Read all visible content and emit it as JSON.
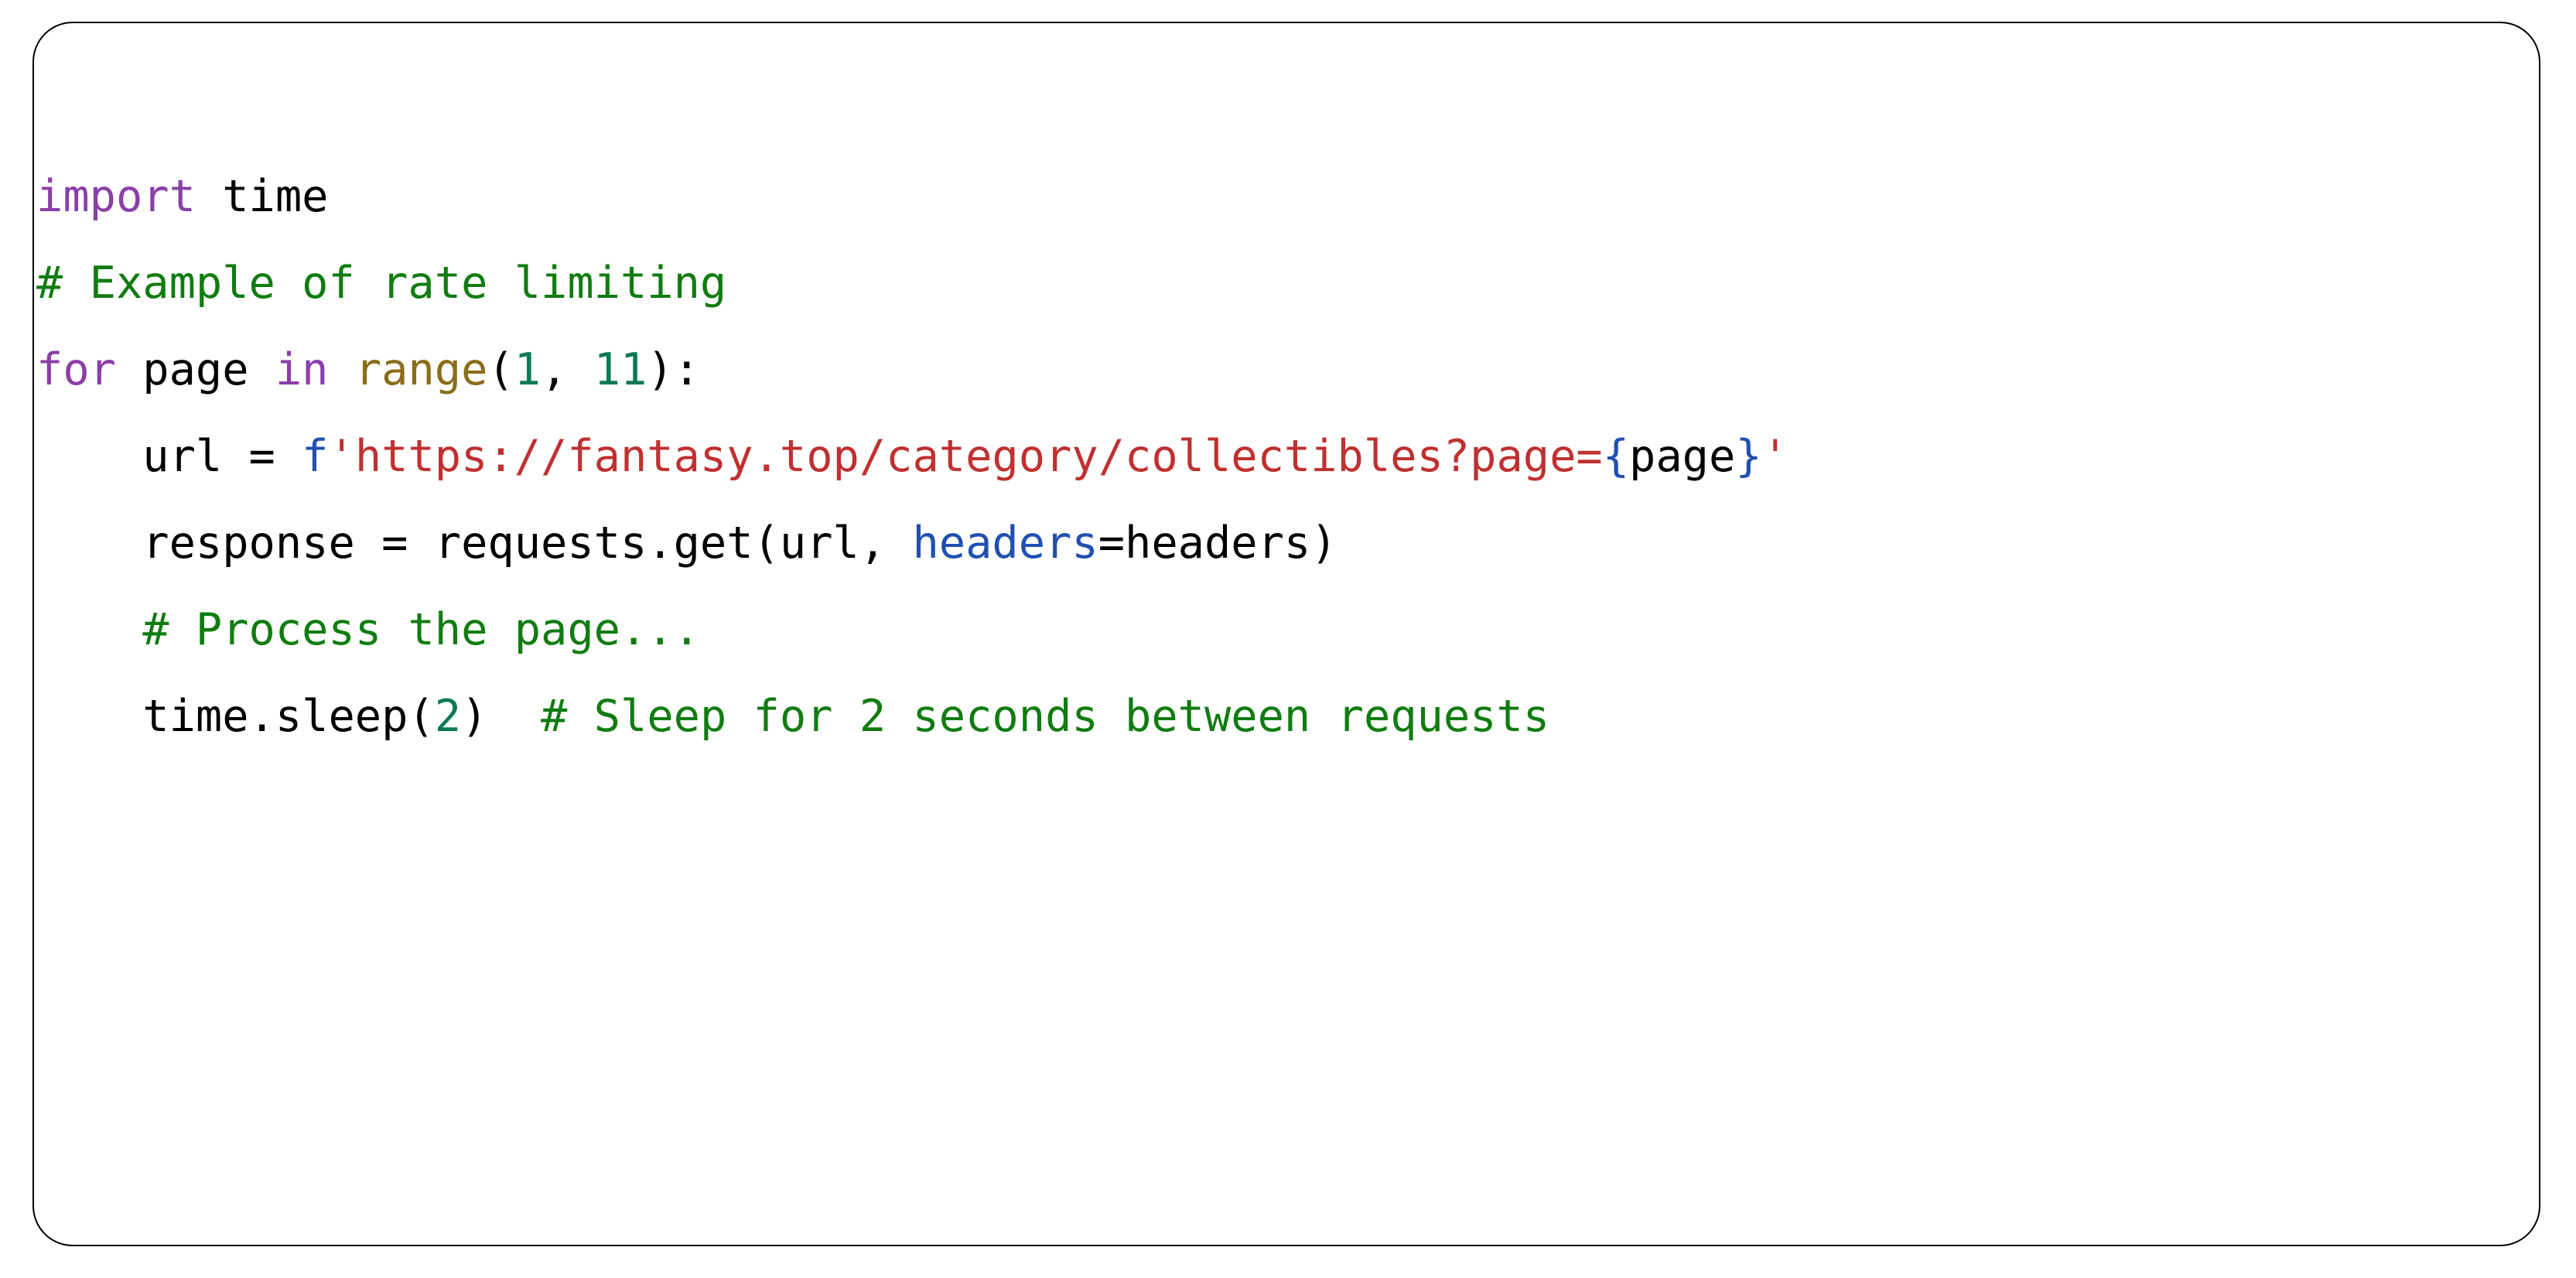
{
  "card": {
    "border_color": "#000000",
    "background": "#ffffff",
    "corner_radius_px": 52
  },
  "code": {
    "language": "python",
    "font_size_px": 57,
    "line_height_px": 112,
    "theme_colors": {
      "keyword": "#8a3fa8",
      "comment": "#107c10",
      "builtin": "#8a6d1a",
      "number": "#0a7a55",
      "string": "#c03030",
      "fstring_prefix": "#2050b0",
      "fstring_brace": "#2050b0",
      "keyword_argument": "#2050b0",
      "plain": "#000000"
    },
    "plain_text": "import time\n# Example of rate limiting\nfor page in range(1, 11):\n    url = f'https://fantasy.top/category/collectibles?page={page}'\n    response = requests.get(url, headers=headers)\n    # Process the page...\n    time.sleep(2)  # Sleep for 2 seconds between requests",
    "lines": [
      {
        "index": 1,
        "tokens": [
          {
            "t": "import",
            "k": "keyword"
          },
          {
            "t": " time",
            "k": "plain"
          }
        ]
      },
      {
        "index": 2,
        "tokens": [
          {
            "t": "# Example of rate limiting",
            "k": "comment"
          }
        ]
      },
      {
        "index": 3,
        "tokens": [
          {
            "t": "for",
            "k": "keyword"
          },
          {
            "t": " page ",
            "k": "plain"
          },
          {
            "t": "in",
            "k": "keyword"
          },
          {
            "t": " ",
            "k": "plain"
          },
          {
            "t": "range",
            "k": "builtin"
          },
          {
            "t": "(",
            "k": "plain"
          },
          {
            "t": "1",
            "k": "number"
          },
          {
            "t": ", ",
            "k": "plain"
          },
          {
            "t": "11",
            "k": "number"
          },
          {
            "t": "):",
            "k": "plain"
          }
        ]
      },
      {
        "index": 4,
        "tokens": [
          {
            "t": "    url = ",
            "k": "plain"
          },
          {
            "t": "f",
            "k": "fprefix"
          },
          {
            "t": "'https://fantasy.top/category/collectibles?page=",
            "k": "string"
          },
          {
            "t": "{",
            "k": "brace"
          },
          {
            "t": "page",
            "k": "plain"
          },
          {
            "t": "}",
            "k": "brace"
          },
          {
            "t": "'",
            "k": "string"
          }
        ]
      },
      {
        "index": 5,
        "tokens": [
          {
            "t": "    response = requests.get(url, ",
            "k": "plain"
          },
          {
            "t": "headers",
            "k": "kwarg"
          },
          {
            "t": "=headers)",
            "k": "plain"
          }
        ]
      },
      {
        "index": 6,
        "tokens": [
          {
            "t": "    ",
            "k": "plain"
          },
          {
            "t": "# Process the page...",
            "k": "comment"
          }
        ]
      },
      {
        "index": 7,
        "tokens": [
          {
            "t": "    time.sleep(",
            "k": "plain"
          },
          {
            "t": "2",
            "k": "number"
          },
          {
            "t": ")  ",
            "k": "plain"
          },
          {
            "t": "# Sleep for 2 seconds between requests",
            "k": "comment"
          }
        ]
      }
    ]
  }
}
